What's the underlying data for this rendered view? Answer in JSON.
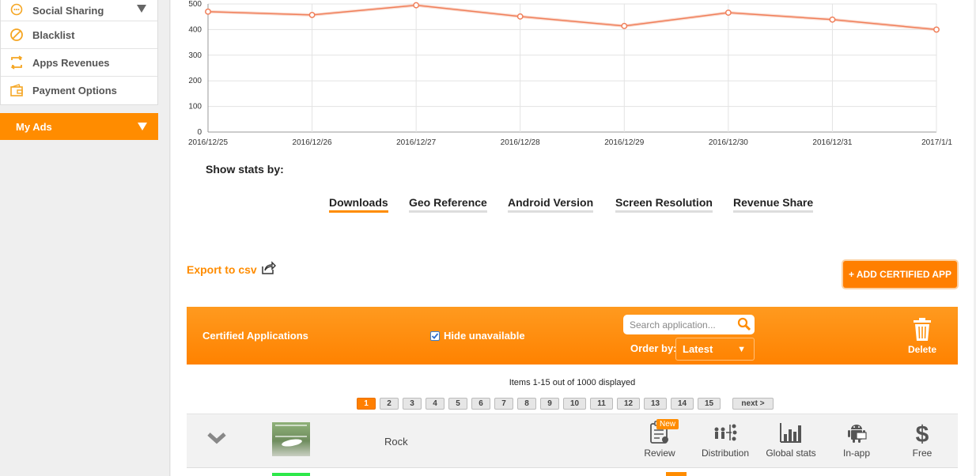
{
  "sidebar": {
    "items": [
      {
        "label": "Social Sharing",
        "icon": "chat-icon"
      },
      {
        "label": "Blacklist",
        "icon": "blacklist-icon"
      },
      {
        "label": "Apps Revenues",
        "icon": "revenue-icon"
      },
      {
        "label": "Payment Options",
        "icon": "wallet-icon"
      }
    ],
    "my_ads": "My Ads"
  },
  "chart_data": {
    "type": "line",
    "x": [
      "2016/12/25",
      "2016/12/26",
      "2016/12/27",
      "2016/12/28",
      "2016/12/29",
      "2016/12/30",
      "2016/12/31",
      "2017/1/1"
    ],
    "series": [
      {
        "values": [
          470,
          457,
          495,
          451,
          414,
          466,
          439,
          400
        ]
      }
    ],
    "yticks": [
      0,
      100,
      200,
      300,
      400,
      500
    ],
    "ylim": [
      0,
      500
    ],
    "grid": true,
    "color": "#f07f5a"
  },
  "stats": {
    "label": "Show stats by:",
    "tabs": [
      "Downloads",
      "Geo Reference",
      "Android Version",
      "Screen Resolution",
      "Revenue Share"
    ],
    "active": "Downloads"
  },
  "export_label": "Export to csv",
  "add_button": "+ ADD CERTIFIED APP",
  "toolbar": {
    "title": "Certified Applications",
    "hide_label": "Hide unavailable",
    "hide_checked": true,
    "search_placeholder": "Search application...",
    "order_label": "Order by:",
    "order_value": "Latest",
    "delete_label": "Delete"
  },
  "items_text": "Items 1-15 out of 1000 displayed",
  "pages": [
    "1",
    "2",
    "3",
    "4",
    "5",
    "6",
    "7",
    "8",
    "9",
    "10",
    "11",
    "12",
    "13",
    "14",
    "15"
  ],
  "current_page": "1",
  "next_label": "next >",
  "row": {
    "name": "Rock",
    "badge": "New",
    "actions": [
      "Review",
      "Distribution",
      "Global stats",
      "In-app",
      "Free"
    ]
  },
  "colors": {
    "accent": "#ff8c00",
    "chart_line": "#f07f5a"
  }
}
